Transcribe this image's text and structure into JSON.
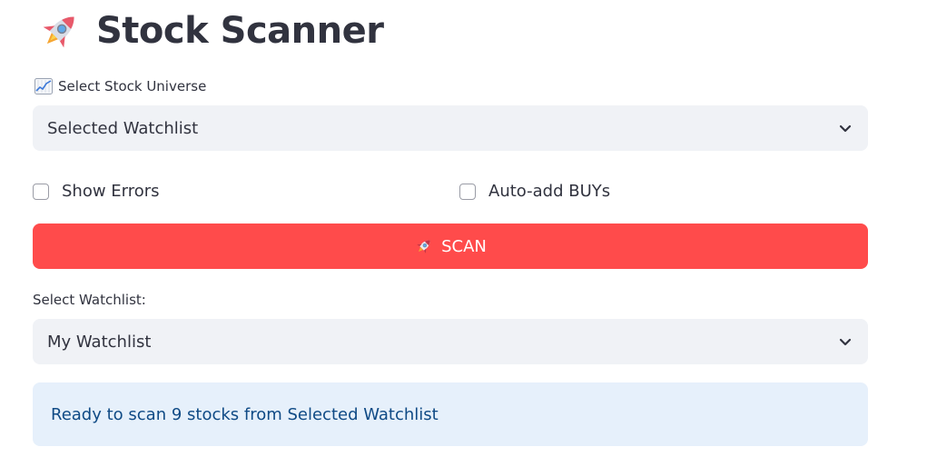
{
  "header": {
    "icon": "rocket-icon",
    "title": "Stock Scanner"
  },
  "universe": {
    "icon": "chart-increasing-icon",
    "label": "Select Stock Universe",
    "selected": "Selected Watchlist"
  },
  "options": {
    "show_errors": {
      "label": "Show Errors",
      "checked": false
    },
    "auto_add_buys": {
      "label": "Auto-add BUYs",
      "checked": false
    }
  },
  "scan_button": {
    "icon": "rocket-icon",
    "label": "SCAN",
    "color": "#ff4b4b"
  },
  "watchlist": {
    "label": "Select Watchlist:",
    "selected": "My Watchlist"
  },
  "info": {
    "message": "Ready to scan 9 stocks from Selected Watchlist"
  }
}
